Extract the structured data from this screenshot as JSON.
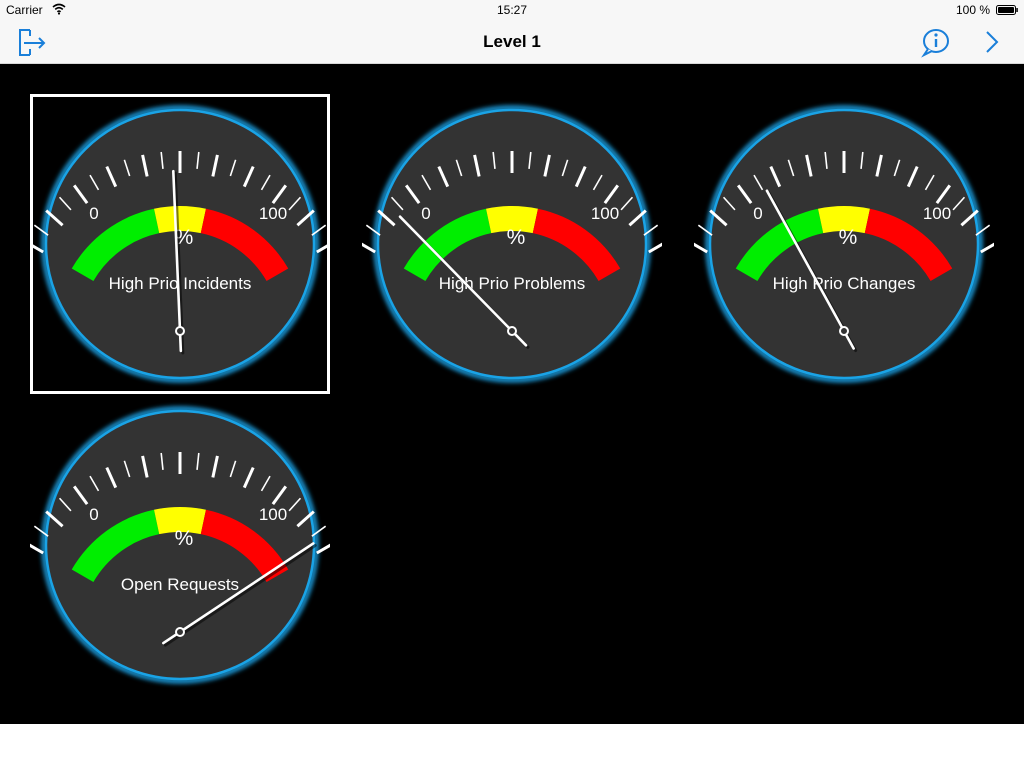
{
  "status_bar": {
    "carrier": "Carrier",
    "time": "15:27",
    "battery": "100 %"
  },
  "nav": {
    "title": "Level 1",
    "left_icon": "logout-icon",
    "right_icons": [
      "info-icon",
      "chevron-right-icon"
    ]
  },
  "colors": {
    "accent": "#1a7fd9",
    "gauge_face": "#333333",
    "gauge_rim": "#1aa3e6",
    "zone_low": "#00ee00",
    "zone_mid": "#ffff00",
    "zone_high": "#ff0000"
  },
  "gauges": [
    {
      "label": "High Prio Incidents",
      "unit": "%",
      "min": "0",
      "max": "100",
      "value": 48,
      "selected": true
    },
    {
      "label": "High Prio Problems",
      "unit": "%",
      "min": "0",
      "max": "100",
      "value": 13,
      "selected": false
    },
    {
      "label": "High Prio Changes",
      "unit": "%",
      "min": "0",
      "max": "100",
      "value": 26,
      "selected": false
    },
    {
      "label": "Open Requests",
      "unit": "%",
      "min": "0",
      "max": "100",
      "value": 97,
      "selected": false
    }
  ]
}
